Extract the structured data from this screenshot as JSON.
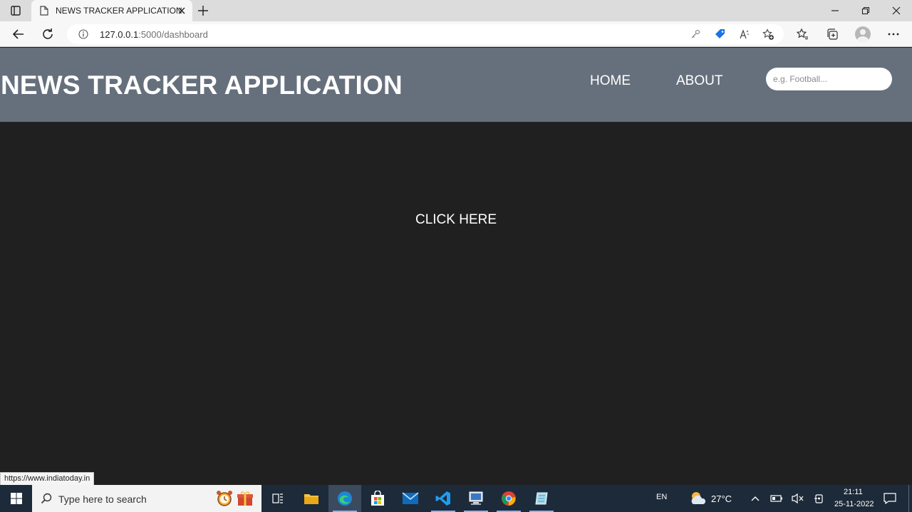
{
  "browser": {
    "tab_title": "NEWS TRACKER APPLICATION",
    "url_host": "127.0.0.1",
    "url_rest": ":5000/dashboard",
    "status_url": "https://www.indiatoday.in"
  },
  "header": {
    "title": "NEWS TRACKER APPLICATION",
    "nav": [
      {
        "label": "HOME"
      },
      {
        "label": "ABOUT"
      }
    ],
    "search_placeholder": "e.g. Football..."
  },
  "main": {
    "cta_label": "CLICK HERE"
  },
  "taskbar": {
    "search_placeholder": "Type here to search",
    "language": "EN",
    "temperature": "27°C",
    "time": "21:11",
    "date": "25-11-2022"
  },
  "icons": {
    "tab_actions": "tab-actions-icon",
    "page": "document-icon",
    "close": "close-icon",
    "new_tab": "plus-icon",
    "back": "back-arrow-icon",
    "refresh": "refresh-icon",
    "info": "info-icon",
    "key": "key-icon",
    "tag": "tag-icon",
    "read_aloud": "read-aloud-icon",
    "favorite_add": "star-plus-icon",
    "favorites": "favorites-icon",
    "collections": "collections-icon",
    "more": "more-icon"
  },
  "colors": {
    "header_bg": "#66707c",
    "page_bg": "#202020",
    "taskbar_bg": "#1d2a39"
  }
}
